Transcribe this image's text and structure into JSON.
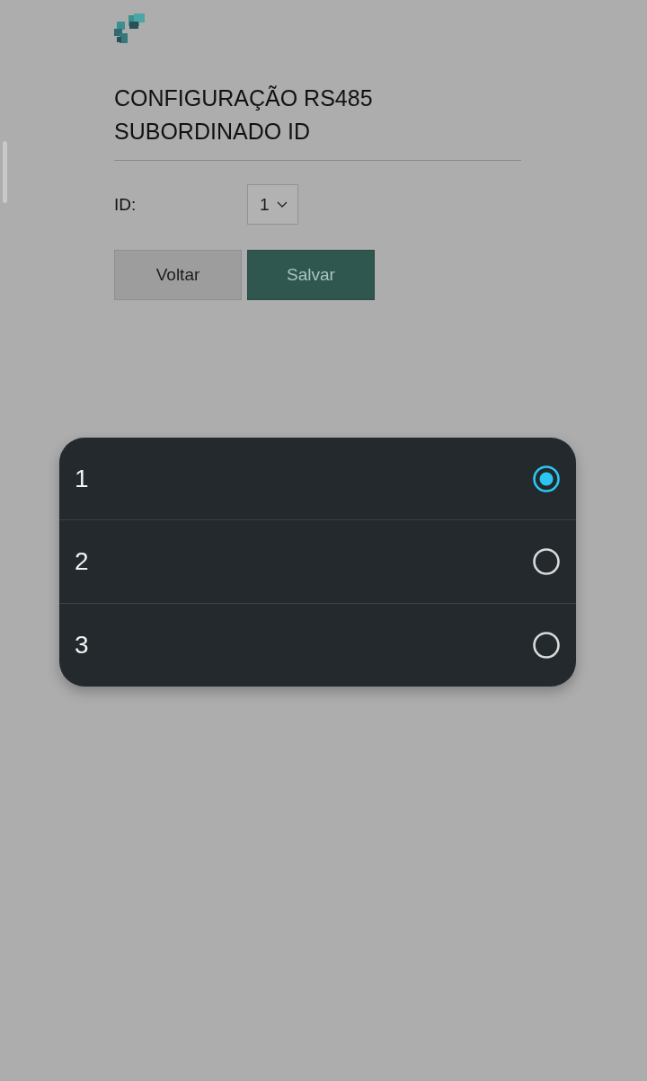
{
  "header": {
    "title": "CONFIGURAÇÃO RS485 SUBORDINADO ID"
  },
  "form": {
    "id_label": "ID:",
    "id_select": {
      "value": "1"
    }
  },
  "buttons": [
    {
      "label": "Voltar",
      "kind": "secondary"
    },
    {
      "label": "Salvar",
      "kind": "primary"
    }
  ],
  "picker": {
    "options": [
      {
        "label": "1",
        "selected": true
      },
      {
        "label": "2",
        "selected": false
      },
      {
        "label": "3",
        "selected": false
      }
    ]
  }
}
